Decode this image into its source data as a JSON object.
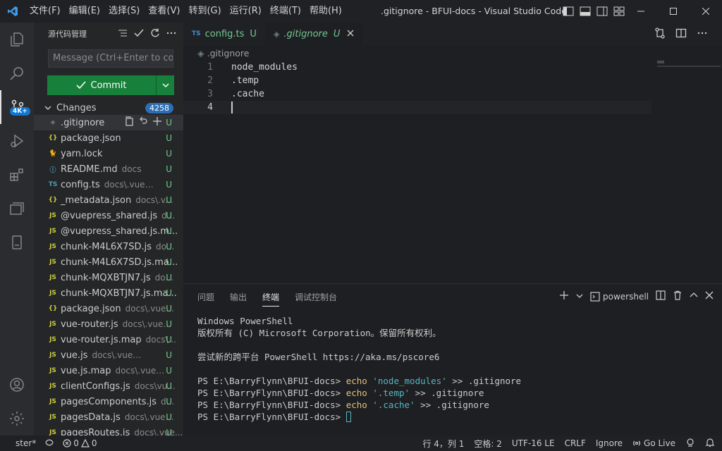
{
  "titlebar": {
    "menu": [
      "文件(F)",
      "编辑(E)",
      "选择(S)",
      "查看(V)",
      "转到(G)",
      "运行(R)",
      "终端(T)",
      "帮助(H)"
    ],
    "title": ".gitignore - BFUI-docs - Visual Studio Code"
  },
  "activity": {
    "badge": "4K+"
  },
  "sidebar": {
    "title": "源代码管理",
    "message_placeholder": "Message (Ctrl+Enter to co...",
    "commit_label": "Commit",
    "changes_label": "Changes",
    "changes_count": "4258",
    "files": [
      {
        "icon": "◈",
        "icon_color": "#6d8086",
        "name": ".gitignore",
        "dir": "",
        "status": "U"
      },
      {
        "icon": "{}",
        "icon_color": "#cbcb41",
        "name": "package.json",
        "dir": "",
        "status": "U"
      },
      {
        "icon": "🐈",
        "icon_color": "#2c8ebb",
        "name": "yarn.lock",
        "dir": "",
        "status": "U"
      },
      {
        "icon": "ⓘ",
        "icon_color": "#519aba",
        "name": "README.md",
        "dir": "docs",
        "status": "U"
      },
      {
        "icon": "TS",
        "icon_color": "#519aba",
        "name": "config.ts",
        "dir": "docs\\.vuepress",
        "status": "U"
      },
      {
        "icon": "{}",
        "icon_color": "#cbcb41",
        "name": "_metadata.json",
        "dir": "docs\\.v...",
        "status": "U"
      },
      {
        "icon": "JS",
        "icon_color": "#cbcb41",
        "name": "@vuepress_shared.js",
        "dir": "d...",
        "status": "U"
      },
      {
        "icon": "JS",
        "icon_color": "#cbcb41",
        "name": "@vuepress_shared.js.m...",
        "dir": "",
        "status": "U"
      },
      {
        "icon": "JS",
        "icon_color": "#cbcb41",
        "name": "chunk-M4L6X7SD.js",
        "dir": "do...",
        "status": "U"
      },
      {
        "icon": "JS",
        "icon_color": "#cbcb41",
        "name": "chunk-M4L6X7SD.js.ma...",
        "dir": "",
        "status": "U"
      },
      {
        "icon": "JS",
        "icon_color": "#cbcb41",
        "name": "chunk-MQXBTJN7.js",
        "dir": "do...",
        "status": "U"
      },
      {
        "icon": "JS",
        "icon_color": "#cbcb41",
        "name": "chunk-MQXBTJN7.js.ma...",
        "dir": "",
        "status": "U"
      },
      {
        "icon": "{}",
        "icon_color": "#cbcb41",
        "name": "package.json",
        "dir": "docs\\.vue...",
        "status": "U"
      },
      {
        "icon": "JS",
        "icon_color": "#cbcb41",
        "name": "vue-router.js",
        "dir": "docs\\.vuep...",
        "status": "U"
      },
      {
        "icon": "JS",
        "icon_color": "#cbcb41",
        "name": "vue-router.js.map",
        "dir": "docs\\...",
        "status": "U"
      },
      {
        "icon": "JS",
        "icon_color": "#cbcb41",
        "name": "vue.js",
        "dir": "docs\\.vuepress\\ca...",
        "status": "U"
      },
      {
        "icon": "JS",
        "icon_color": "#cbcb41",
        "name": "vue.js.map",
        "dir": "docs\\.vuepre...",
        "status": "U"
      },
      {
        "icon": "JS",
        "icon_color": "#cbcb41",
        "name": "clientConfigs.js",
        "dir": "docs\\vu...",
        "status": "U"
      },
      {
        "icon": "JS",
        "icon_color": "#cbcb41",
        "name": "pagesComponents.js",
        "dir": "d...",
        "status": "U"
      },
      {
        "icon": "JS",
        "icon_color": "#cbcb41",
        "name": "pagesData.js",
        "dir": "docs\\.vuep...",
        "status": "U"
      },
      {
        "icon": "JS",
        "icon_color": "#cbcb41",
        "name": "pagesRoutes.js",
        "dir": "docs\\.vue...",
        "status": "U"
      }
    ]
  },
  "tabs": [
    {
      "prefix": "TS",
      "label": "config.ts",
      "status": "U",
      "active": false
    },
    {
      "prefix": "◈",
      "label": ".gitignore",
      "status": "U",
      "active": true
    }
  ],
  "editor": {
    "breadcrumb": ".gitignore",
    "lines": [
      {
        "n": "1",
        "text": "node_modules"
      },
      {
        "n": "2",
        "text": ".temp"
      },
      {
        "n": "3",
        "text": ".cache"
      },
      {
        "n": "4",
        "text": ""
      }
    ]
  },
  "panel": {
    "tabs": [
      "问题",
      "输出",
      "终端",
      "调试控制台"
    ],
    "active_tab": "终端",
    "shell": "powershell",
    "terminal": {
      "line1": "Windows PowerShell",
      "line2": "版权所有 (C) Microsoft Corporation。保留所有权利。",
      "line3": "尝试新的跨平台 PowerShell https://aka.ms/pscore6",
      "prompt": "PS E:\\BarryFlynn\\BFUI-docs> ",
      "cmd": "echo",
      "commands": [
        {
          "arg": "'node_modules'",
          "rest": " >> .gitignore"
        },
        {
          "arg": "'.temp'",
          "rest": " >> .gitignore"
        },
        {
          "arg": "'.cache'",
          "rest": " >> .gitignore"
        }
      ]
    }
  },
  "statusbar": {
    "branch": "ster*",
    "errors": "0",
    "warnings": "0",
    "position": "行 4，列 1",
    "spaces": "空格: 2",
    "encoding": "UTF-16 LE",
    "eol": "CRLF",
    "language": "Ignore",
    "golive": "Go Live"
  },
  "colors": {
    "accent": "#0e78d4",
    "commit": "#17803a",
    "untracked": "#73c991"
  }
}
